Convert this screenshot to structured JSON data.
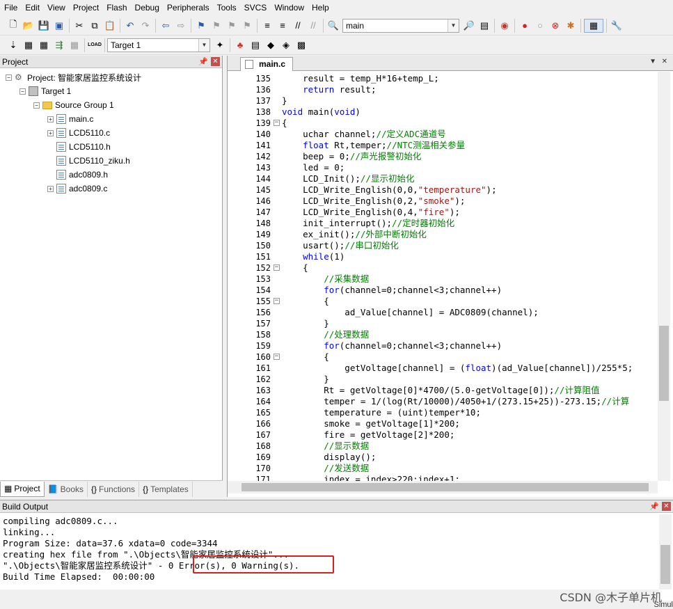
{
  "menu": [
    "File",
    "Edit",
    "View",
    "Project",
    "Flash",
    "Debug",
    "Peripherals",
    "Tools",
    "SVCS",
    "Window",
    "Help"
  ],
  "toolbar1": {
    "find_combo_value": "main"
  },
  "toolbar2": {
    "target_combo_value": "Target 1",
    "load_label": "LOAD"
  },
  "project_panel": {
    "title": "Project",
    "tree": {
      "project": "Project: 智能家居监控系统设计",
      "target": "Target 1",
      "group": "Source Group 1",
      "files": [
        "main.c",
        "LCD5110.c",
        "LCD5110.h",
        "LCD5110_ziku.h",
        "adc0809.h",
        "adc0809.c"
      ]
    },
    "tabs": [
      "Project",
      "Books",
      "Functions",
      "Templates"
    ]
  },
  "editor": {
    "active_tab": "main.c",
    "lines": [
      {
        "n": "135",
        "code": "    result = temp_H*16+temp_L;"
      },
      {
        "n": "136",
        "code": "    return result;"
      },
      {
        "n": "137",
        "code": "}"
      },
      {
        "n": "138",
        "code": "void main(void)"
      },
      {
        "n": "139",
        "code": "{"
      },
      {
        "n": "140",
        "code": "    uchar channel;//定义ADC通道号"
      },
      {
        "n": "141",
        "code": "    float Rt,temper;//NTC测温相关参量"
      },
      {
        "n": "142",
        "code": "    beep = 0;//声光报警初始化"
      },
      {
        "n": "143",
        "code": "    led = 0;"
      },
      {
        "n": "144",
        "code": "    LCD_Init();//显示初始化"
      },
      {
        "n": "145",
        "code": "    LCD_Write_English(0,0,\"temperature\");"
      },
      {
        "n": "146",
        "code": "    LCD_Write_English(0,2,\"smoke\");"
      },
      {
        "n": "147",
        "code": "    LCD_Write_English(0,4,\"fire\");"
      },
      {
        "n": "148",
        "code": "    init_interrupt();//定时器初始化"
      },
      {
        "n": "149",
        "code": "    ex_init();//外部中断初始化"
      },
      {
        "n": "150",
        "code": "    usart();//串口初始化"
      },
      {
        "n": "151",
        "code": "    while(1)"
      },
      {
        "n": "152",
        "code": "    {"
      },
      {
        "n": "153",
        "code": "        //采集数据"
      },
      {
        "n": "154",
        "code": "        for(channel=0;channel<3;channel++)"
      },
      {
        "n": "155",
        "code": "        {"
      },
      {
        "n": "156",
        "code": "            ad_Value[channel] = ADC0809(channel);"
      },
      {
        "n": "157",
        "code": "        }"
      },
      {
        "n": "158",
        "code": "        //处理数据"
      },
      {
        "n": "159",
        "code": "        for(channel=0;channel<3;channel++)"
      },
      {
        "n": "160",
        "code": "        {"
      },
      {
        "n": "161",
        "code": "            getVoltage[channel] = (float)(ad_Value[channel])/255*5;"
      },
      {
        "n": "162",
        "code": "        }"
      },
      {
        "n": "163",
        "code": "        Rt = getVoltage[0]*4700/(5.0-getVoltage[0]);//计算阻值"
      },
      {
        "n": "164",
        "code": "        temper = 1/(log(Rt/10000)/4050+1/(273.15+25))-273.15;//计算"
      },
      {
        "n": "165",
        "code": "        temperature = (uint)temper*10;"
      },
      {
        "n": "166",
        "code": "        smoke = getVoltage[1]*200;"
      },
      {
        "n": "167",
        "code": "        fire = getVoltage[2]*200;"
      },
      {
        "n": "168",
        "code": "        //显示数据"
      },
      {
        "n": "169",
        "code": "        display();"
      },
      {
        "n": "170",
        "code": "        //发送数据"
      },
      {
        "n": "171",
        "code": "        index = index>220:index+1;"
      }
    ]
  },
  "build_output": {
    "title": "Build Output",
    "lines": [
      "compiling adc0809.c...",
      "linking...",
      "Program Size: data=37.6 xdata=0 code=3344",
      "creating hex file from \".\\Objects\\智能家居监控系统设计\"...",
      "\".\\Objects\\智能家居监控系统设计\" - 0 Error(s), 0 Warning(s).",
      "Build Time Elapsed:  00:00:00"
    ]
  },
  "status": {
    "simulation": "Simul"
  },
  "credit": "CSDN @木子单片机",
  "colors": {
    "keyword": "#0000ff",
    "comment": "#008000",
    "string": "#a31515",
    "highlight_box": "#d9201c"
  }
}
